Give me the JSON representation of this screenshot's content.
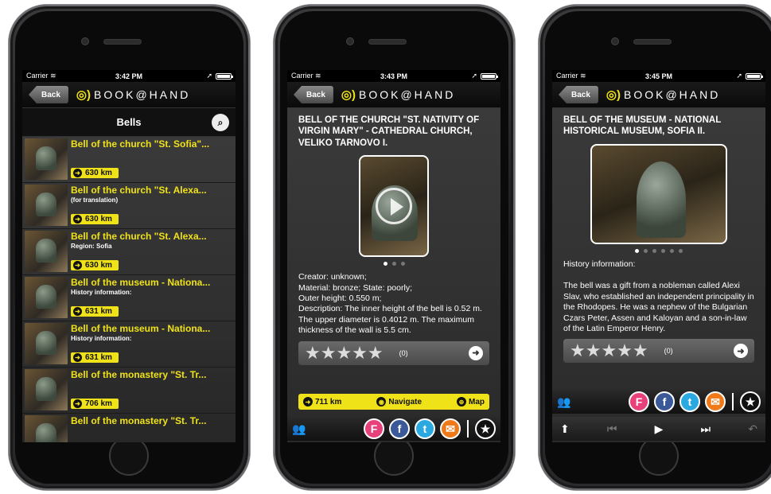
{
  "status": {
    "carrier": "Carrier",
    "times": [
      "3:42 PM",
      "3:43 PM",
      "3:45 PM"
    ]
  },
  "nav": {
    "back_label": "Back",
    "brand": "BOOK@HAND"
  },
  "screen1": {
    "header_title": "Bells",
    "items": [
      {
        "title": "Bell of the church \"St. Sofia\"...",
        "subtitle": "",
        "distance": "630 km"
      },
      {
        "title": "Bell of the church \"St. Alexa...",
        "subtitle": "(for translation)",
        "distance": "630 km"
      },
      {
        "title": "Bell of the church \"St. Alexa...",
        "subtitle": "Region:   Sofia",
        "distance": "630 km"
      },
      {
        "title": "Bell of the museum - Nationa...",
        "subtitle": "History information:",
        "distance": "631 km"
      },
      {
        "title": "Bell of the museum - Nationa...",
        "subtitle": "History information:",
        "distance": "631 km"
      },
      {
        "title": "Bell of the monastery \"St. Tr...",
        "subtitle": "",
        "distance": "706 km"
      },
      {
        "title": "Bell of the monastery \"St. Tr...",
        "subtitle": "",
        "distance": ""
      }
    ]
  },
  "screen2": {
    "title": "BELL OF THE CHURCH \"ST. NATIVITY OF VIRGIN MARY\" - CATHEDRAL CHURCH, VELIKO TARNOVO I.",
    "desc": [
      "Creator: unknown;",
      "Material: bronze; State: poorly;",
      "Outer height: 0.550 m;",
      "Description: The inner height of the bell is 0.52 m. The upper diameter is 0.4012 m. The maximum thickness of the wall is 5.5 cm."
    ],
    "rating_count": "(0)",
    "stars": 5,
    "actions": {
      "distance": "711 km",
      "navigate": "Navigate",
      "map": "Map"
    }
  },
  "screen3": {
    "title": "BELL OF THE MUSEUM - NATIONAL HISTORICAL MUSEUM, SOFIA II.",
    "history_label": "History information:",
    "history_text": "The bell was a gift from a nobleman called Alexi Slav, who established an independent principality in the Rhodopes. He was a nephew of the Bulgarian Czars Peter, Assen and Kaloyan and a son-in-law of the Latin Emperor Henry.",
    "rating_count": "(0)",
    "stars": 5
  },
  "colors": {
    "accent": "#f0e219",
    "background": "#2a2a2a"
  },
  "icons": [
    "search-icon",
    "wifi-icon",
    "location-arrow-icon",
    "battery-icon",
    "arrow-right-icon",
    "navigate-icon",
    "map-icon",
    "people-icon",
    "foursquare-icon",
    "facebook-icon",
    "twitter-icon",
    "mail-icon",
    "favorite-star-icon",
    "play-icon",
    "up-arrow-icon",
    "previous-track-icon",
    "next-track-icon",
    "undo-icon"
  ]
}
